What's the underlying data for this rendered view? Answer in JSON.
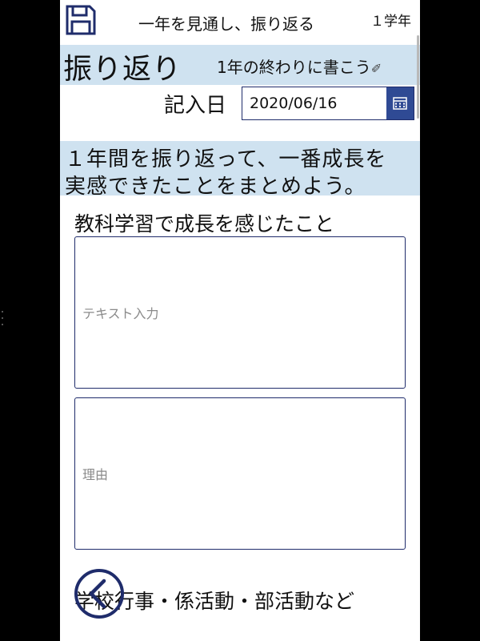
{
  "header": {
    "title": "一年を見通し、振り返る",
    "grade": "１学年"
  },
  "section": {
    "title": "振り返り",
    "subtitle": "1年の終わりに書こう",
    "subtitle_icon": "pencil-icon"
  },
  "date": {
    "label": "記入日",
    "value": "2020/06/16"
  },
  "instruction": {
    "line1": "１年間を振り返って、一番成長を",
    "line2": "実感できたことをまとめよう。"
  },
  "question1": {
    "label": "教科学習で成長を感じたこと",
    "text_placeholder": "テキスト入力",
    "reason_placeholder": "理由"
  },
  "question2": {
    "label": "学校行事・係活動・部活動など"
  },
  "colors": {
    "accent": "#1f2c6b",
    "section_bg": "#cfe2f0",
    "calendar_button": "#2f4a94"
  }
}
